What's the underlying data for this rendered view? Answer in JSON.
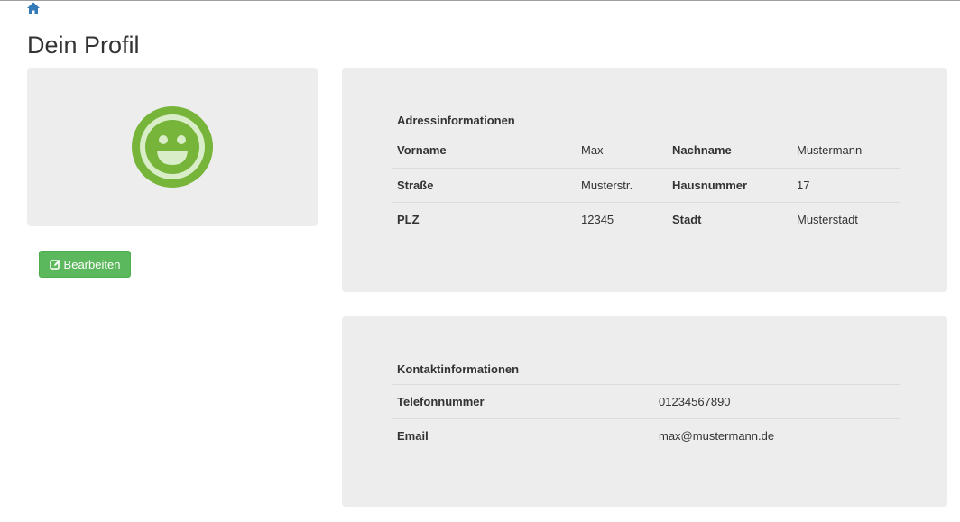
{
  "nav": {
    "home_icon": "home-icon"
  },
  "page": {
    "title": "Dein Profil"
  },
  "profile": {
    "avatar_icon": "smiley-face-icon",
    "avatar_color": "#76b43a",
    "edit_button": {
      "label": "Bearbeiten",
      "icon": "edit-icon",
      "color": "#5cb85c"
    }
  },
  "address": {
    "title": "Adressinformationen",
    "rows": [
      {
        "label1": "Vorname",
        "value1": "Max",
        "label2": "Nachname",
        "value2": "Mustermann"
      },
      {
        "label1": "Straße",
        "value1": "Musterstr.",
        "label2": "Hausnummer",
        "value2": "17"
      },
      {
        "label1": "PLZ",
        "value1": "12345",
        "label2": "Stadt",
        "value2": "Musterstadt"
      }
    ]
  },
  "contact": {
    "title": "Kontaktinformationen",
    "rows": [
      {
        "label": "Telefonnummer",
        "value": "01234567890"
      },
      {
        "label": "Email",
        "value": "max@mustermann.de"
      }
    ]
  }
}
